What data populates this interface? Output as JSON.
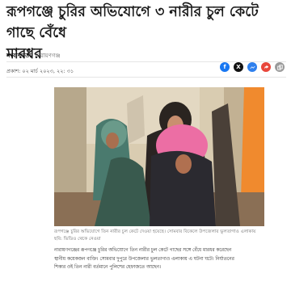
{
  "article": {
    "headline_line1": "রূপগঞ্জে চুরির অভিযোগে ৩ নারীর চুল কেটে গাছে বেঁধে",
    "headline_line2": "মারধর",
    "author": "সংবাদদাতা",
    "location": "নারায়ণগঞ্জ",
    "published": "প্রকাশ: ০২ মার্চ ২০২৩, ২২: ৩১",
    "image_caption": "রূপগঞ্জে চুরির অভিযোগে তিন নারীর চুল কেটে দেওয়া হয়েছে। সোমবার বিকেলে উপজেলার ভুলতাগাও এলাকায়",
    "image_credit": "ছবি: ভিডিও থেকে নেওয়া",
    "body_line1": "নারায়ণগঞ্জের রূপগঞ্জে চুরির অভিযোগে তিন নারীর চুল কেটে গাছের সঙ্গে বেঁধে মারধর করেছেন",
    "body_line2": "স্থানীয় কয়েকজন ব্যক্তি। সোমবার দুপুরে উপজেলার ভুলতাগাও এলাকায় এ ঘটনা ঘটে। নির্যাতনের",
    "body_line3": "শিকার ওই তিন নারী বর্তমানে পুলিশের হেফাজতে আছেন।"
  },
  "share": {
    "icons": [
      "facebook-icon",
      "x-twitter-icon",
      "messenger-icon",
      "share-icon",
      "copy-link-icon"
    ],
    "colors": {
      "facebook": "#1877f2",
      "x": "#111111",
      "messenger": "#2f80ed",
      "share": "#e8463a",
      "copy": "#9a9a9a"
    }
  }
}
